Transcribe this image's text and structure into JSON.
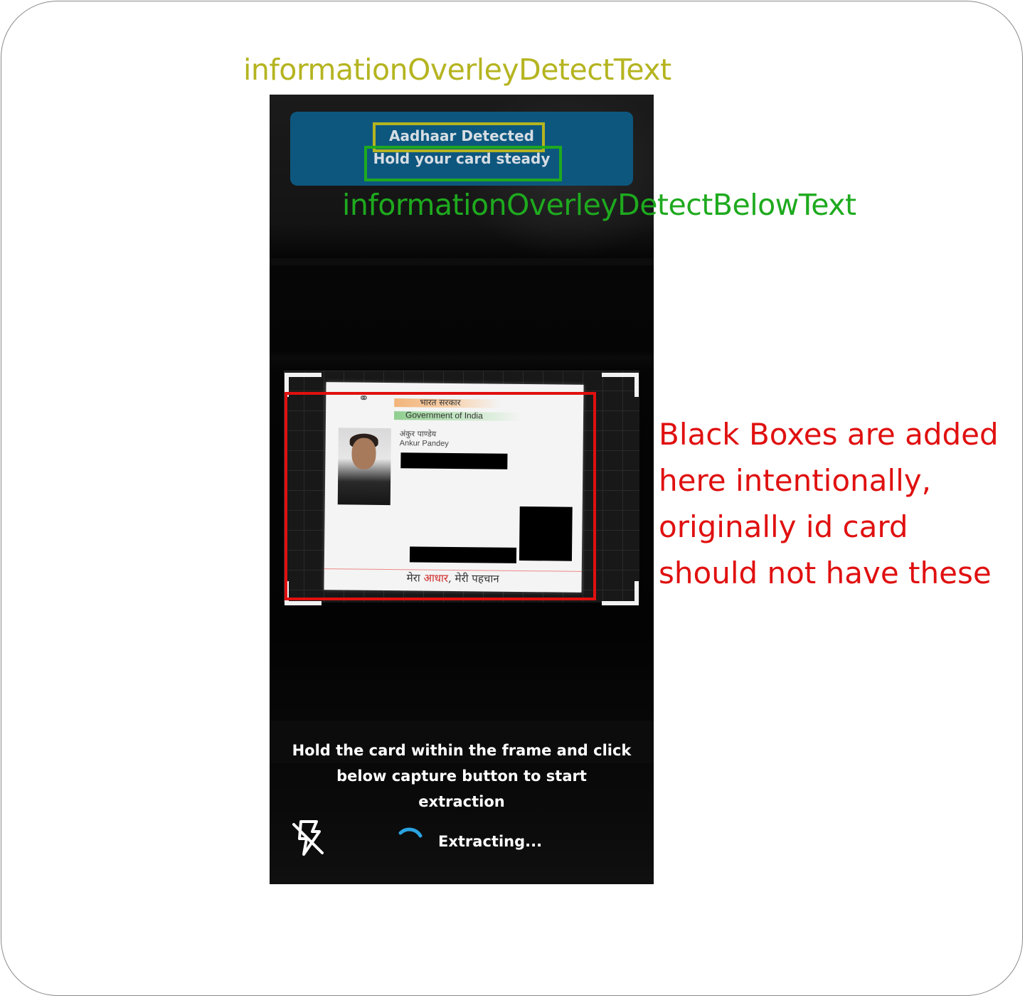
{
  "annotations": {
    "detect_label": "informationOverleyDetectText",
    "detect_color": "#b5b420",
    "below_label": "informationOverleyDetectBelowText",
    "below_color": "#1eaa1e",
    "note": "Black Boxes are added here intentionally, originally id card should not have these",
    "note_color": "#e01010"
  },
  "overlay": {
    "title": "Aadhaar Detected",
    "subtitle": "Hold your card steady",
    "banner_color": "#0d577f"
  },
  "card": {
    "hindi_header": "भारत सरकार",
    "english_header": "Government of India",
    "name_hindi": "अंकुर पाण्डेय",
    "name_english": "Ankur Pandey",
    "footer_part1": "मेरा ",
    "footer_part2": "आधार",
    "footer_part3": ", मेरी पहचान"
  },
  "instructions": {
    "hint": "Hold the card within the frame and click below capture button to start extraction"
  },
  "controls": {
    "flash_icon": "flash-off-icon",
    "status_text": "Extracting...",
    "spinner_color": "#2aa3e0"
  }
}
